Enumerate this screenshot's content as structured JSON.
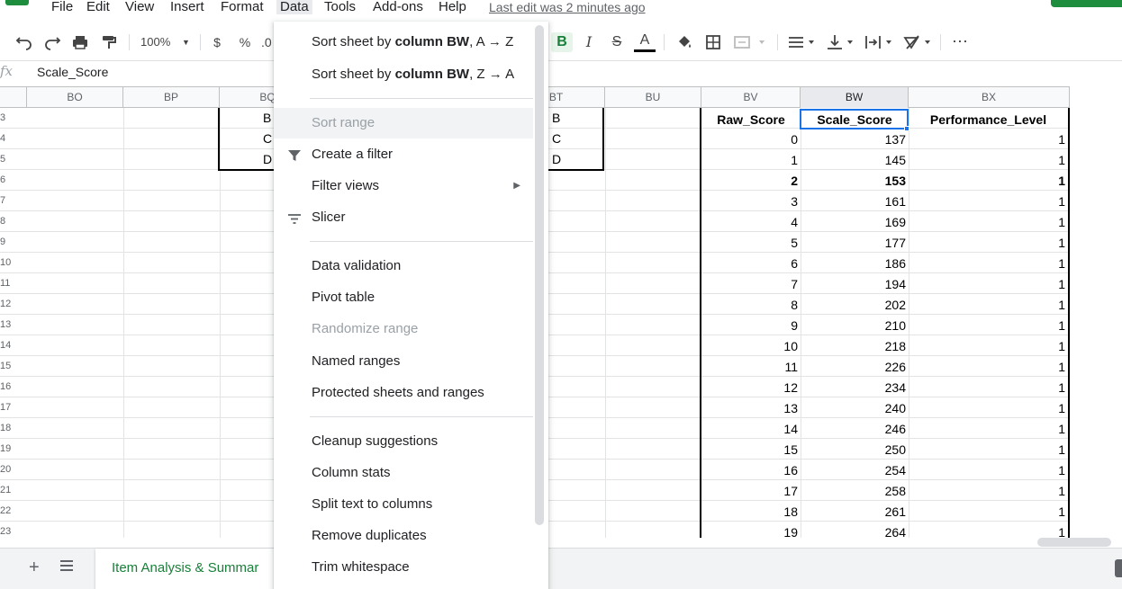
{
  "menubar": {
    "items": [
      "File",
      "Edit",
      "View",
      "Insert",
      "Format",
      "Data",
      "Tools",
      "Add-ons",
      "Help"
    ],
    "last_edit": "Last edit was 2 minutes ago"
  },
  "toolbar": {
    "zoom": "100%",
    "currency": "$",
    "percent": "%",
    "decimal": ".0",
    "bold": "B",
    "italic": "I",
    "strike": "S",
    "text_color": "A",
    "more": "⋯"
  },
  "formula_bar": {
    "fx": "fx",
    "value": "Scale_Score"
  },
  "columns": [
    "BO",
    "BP",
    "BQ",
    "BT",
    "BU",
    "BV",
    "BW",
    "BX"
  ],
  "rows": [
    "3",
    "4",
    "5",
    "6",
    "7",
    "8",
    "9",
    "10",
    "11",
    "12",
    "13",
    "14",
    "15",
    "16",
    "17",
    "18",
    "19",
    "20",
    "21",
    "22",
    "23"
  ],
  "grid": {
    "bq_cells": [
      "B",
      "C",
      "D"
    ],
    "bt_cells": [
      "B",
      "C",
      "D"
    ],
    "headers": {
      "raw": "Raw_Score",
      "scale": "Scale_Score",
      "perf": "Performance_Level"
    },
    "table_rows": [
      {
        "raw": "0",
        "scale": "137",
        "perf": "1"
      },
      {
        "raw": "1",
        "scale": "145",
        "perf": "1"
      },
      {
        "raw": "2",
        "scale": "153",
        "perf": "1"
      },
      {
        "raw": "3",
        "scale": "161",
        "perf": "1"
      },
      {
        "raw": "4",
        "scale": "169",
        "perf": "1"
      },
      {
        "raw": "5",
        "scale": "177",
        "perf": "1"
      },
      {
        "raw": "6",
        "scale": "186",
        "perf": "1"
      },
      {
        "raw": "7",
        "scale": "194",
        "perf": "1"
      },
      {
        "raw": "8",
        "scale": "202",
        "perf": "1"
      },
      {
        "raw": "9",
        "scale": "210",
        "perf": "1"
      },
      {
        "raw": "10",
        "scale": "218",
        "perf": "1"
      },
      {
        "raw": "11",
        "scale": "226",
        "perf": "1"
      },
      {
        "raw": "12",
        "scale": "234",
        "perf": "1"
      },
      {
        "raw": "13",
        "scale": "240",
        "perf": "1"
      },
      {
        "raw": "14",
        "scale": "246",
        "perf": "1"
      },
      {
        "raw": "15",
        "scale": "250",
        "perf": "1"
      },
      {
        "raw": "16",
        "scale": "254",
        "perf": "1"
      },
      {
        "raw": "17",
        "scale": "258",
        "perf": "1"
      },
      {
        "raw": "18",
        "scale": "261",
        "perf": "1"
      },
      {
        "raw": "19",
        "scale": "264",
        "perf": "1"
      }
    ]
  },
  "sheet_tab": {
    "name": "Item Analysis & Summar"
  },
  "data_menu": {
    "sort_az_prefix": "Sort sheet by ",
    "sort_az_col": "column BW",
    "sort_az_suffix": ", A → Z",
    "sort_za_prefix": "Sort sheet by ",
    "sort_za_col": "column BW",
    "sort_za_suffix": ", Z → A",
    "sort_range": "Sort range",
    "create_filter": "Create a filter",
    "filter_views": "Filter views",
    "slicer": "Slicer",
    "data_validation": "Data validation",
    "pivot_table": "Pivot table",
    "randomize_range": "Randomize range",
    "named_ranges": "Named ranges",
    "protected": "Protected sheets and ranges",
    "cleanup": "Cleanup suggestions",
    "column_stats": "Column stats",
    "split_text": "Split text to columns",
    "remove_duplicates": "Remove duplicates",
    "trim_whitespace": "Trim whitespace"
  },
  "colors": {
    "accent": "#1e8e3e",
    "selection": "#1a73e8",
    "disabled_text": "#9aa0a6"
  }
}
